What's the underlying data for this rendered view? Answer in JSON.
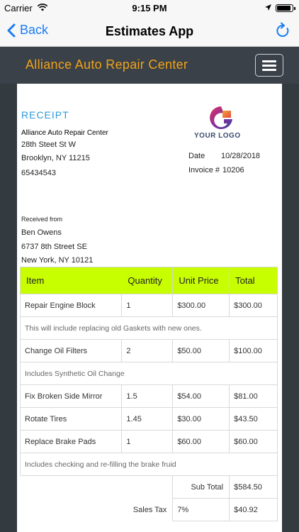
{
  "status": {
    "carrier": "Carrier",
    "time": "9:15 PM"
  },
  "nav": {
    "back_label": "Back",
    "title": "Estimates App"
  },
  "header": {
    "company": "Alliance Auto Repair Center"
  },
  "receipt": {
    "title": "RECEIPT",
    "company_name": "Alliance Auto Repair Center",
    "address_line1": "28th Steet St W",
    "address_line2": "Brooklyn, NY 11215",
    "phone": "65434543",
    "logo_text": "YOUR LOGO",
    "date_label": "Date",
    "date_value": "10/28/2018",
    "invoice_label": "Invoice #",
    "invoice_value": "10206",
    "received_from_label": "Received from",
    "customer_name": "Ben Owens",
    "customer_address1": "6737 8th Street SE",
    "customer_address2": "New York, NY 10121"
  },
  "table": {
    "headers": [
      "Item",
      "Quantity",
      "Unit Price",
      "Total"
    ],
    "rows": [
      {
        "item": "Repair Engine Block",
        "qty": "1",
        "price": "$300.00",
        "total": "$300.00"
      },
      {
        "note": "This will include replacing old Gaskets with new ones."
      },
      {
        "item": "Change Oil Filters",
        "qty": "2",
        "price": "$50.00",
        "total": "$100.00"
      },
      {
        "note": "Includes Synthetic Oil Change"
      },
      {
        "item": "Fix Broken Side Mirror",
        "qty": "1.5",
        "price": "$54.00",
        "total": "$81.00"
      },
      {
        "item": "Rotate Tires",
        "qty": "1.45",
        "price": "$30.00",
        "total": "$43.50"
      },
      {
        "item": "Replace Brake Pads",
        "qty": "1",
        "price": "$60.00",
        "total": "$60.00"
      },
      {
        "note": "Includes checking and re-filling the brake fruid"
      }
    ],
    "subtotal_label": "Sub Total",
    "subtotal_value": "$584.50",
    "tax_label": "Sales Tax",
    "tax_rate": "7%",
    "tax_value": "$40.92"
  },
  "colors": {
    "accent": "#f0a21a",
    "ios_blue": "#1a7cf5",
    "receipt_title": "#2b9ad8",
    "table_header": "#c8ff00",
    "header_bg": "#3a4148"
  },
  "icons": {
    "back": "chevron-left-icon",
    "refresh": "refresh-icon",
    "menu": "hamburger-icon",
    "wifi": "wifi-icon",
    "location": "location-arrow-icon",
    "battery": "battery-icon"
  },
  "battery_level": 0.9
}
